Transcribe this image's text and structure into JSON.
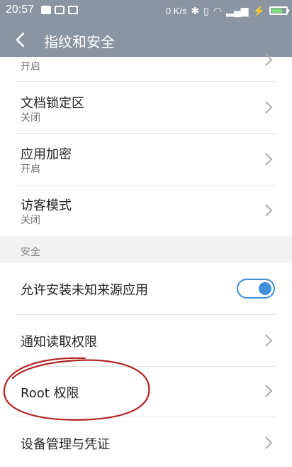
{
  "status_bar": {
    "time": "20:57",
    "net_speed": "0 K/s"
  },
  "header": {
    "title": "指纹和安全",
    "back_icon": "chevron-left-icon"
  },
  "items_top": [
    {
      "title": "",
      "status": "开启"
    },
    {
      "title": "文档锁定区",
      "status": "关闭"
    },
    {
      "title": "应用加密",
      "status": "开启"
    },
    {
      "title": "访客模式",
      "status": "关闭"
    }
  ],
  "section": {
    "label": "安全"
  },
  "items_security": [
    {
      "title": "允许安装未知来源应用",
      "toggle_on": true
    },
    {
      "title": "通知读取权限"
    },
    {
      "title": "Root 权限"
    },
    {
      "title": "设备管理与凭证"
    }
  ],
  "colors": {
    "bar": "#8a95a3",
    "accent": "#3f8fd8",
    "annotation": "#b22222"
  }
}
